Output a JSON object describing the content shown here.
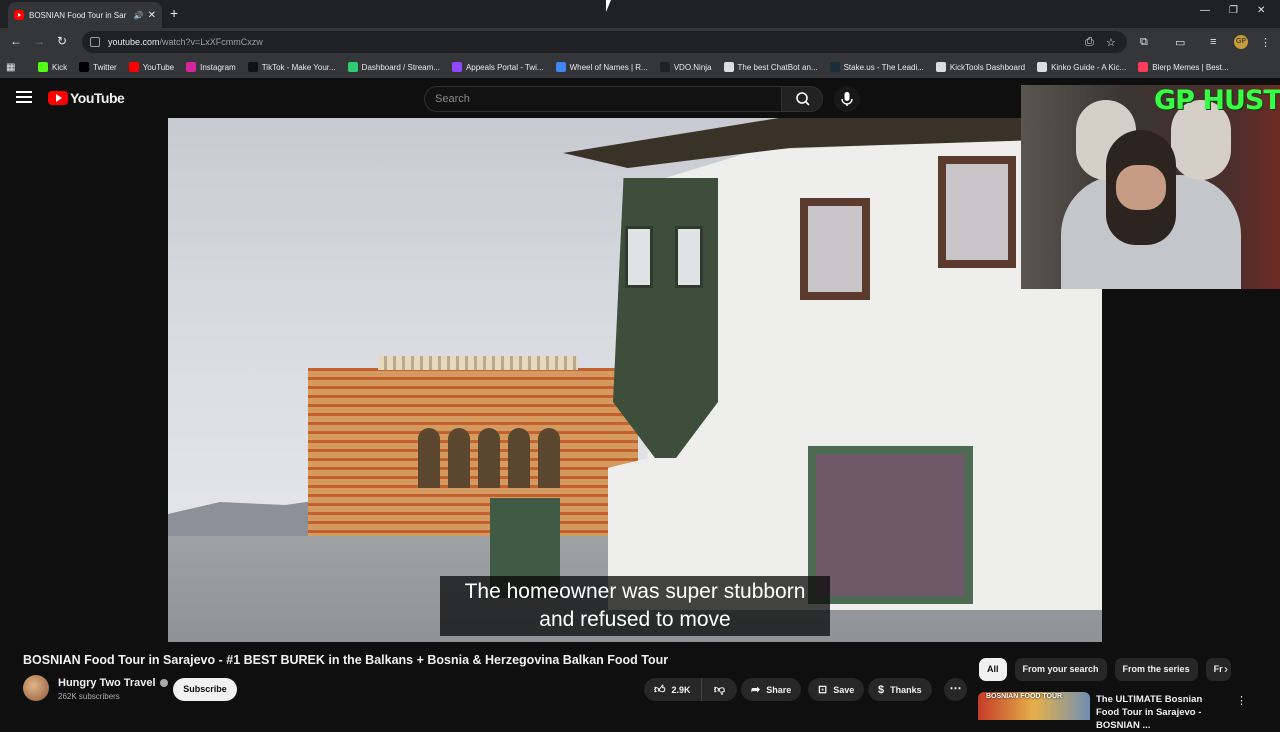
{
  "browser": {
    "tab_title": "BOSNIAN Food Tour in Sar",
    "url_host": "youtube.com",
    "url_path": "/watch?v=LxXFcmmCxzw",
    "profile_initial": "GP",
    "bookmarks": [
      {
        "label": "Kick",
        "color": "#53fc18"
      },
      {
        "label": "Twitter",
        "color": "#000000"
      },
      {
        "label": "YouTube",
        "color": "#ff0000"
      },
      {
        "label": "Instagram",
        "color": "#d6249f"
      },
      {
        "label": "TikTok - Make Your...",
        "color": "#111111"
      },
      {
        "label": "Dashboard / Stream...",
        "color": "#2ecc71"
      },
      {
        "label": "Appeals Portal - Twi...",
        "color": "#9146ff"
      },
      {
        "label": "Wheel of Names | R...",
        "color": "#4285f4"
      },
      {
        "label": "VDO.Ninja",
        "color": "#222222"
      },
      {
        "label": "The best ChatBot an...",
        "color": "#dddddd"
      },
      {
        "label": "Stake.us - The Leadi...",
        "color": "#1a2c38"
      },
      {
        "label": "KickTools Dashboard",
        "color": "#dddddd"
      },
      {
        "label": "Kinko Guide - A Kic...",
        "color": "#dddddd"
      },
      {
        "label": "Blerp Memes | Best...",
        "color": "#ff3b5c"
      }
    ]
  },
  "youtube": {
    "logo_text": "YouTube",
    "search_placeholder": "Search"
  },
  "video": {
    "subtitle_line1": "The homeowner was super stubborn",
    "subtitle_line2": "and refused to move",
    "title": "BOSNIAN Food Tour in Sarajevo - #1 BEST BUREK in the Balkans + Bosnia & Herzegovina Balkan Food Tour"
  },
  "overlay": {
    "brand_text": "GP HUSTLA"
  },
  "channel": {
    "name": "Hungry Two Travel",
    "subscribers": "262K subscribers",
    "subscribe_label": "Subscribe"
  },
  "actions": {
    "likes": "2.9K",
    "share": "Share",
    "save": "Save",
    "thanks": "Thanks"
  },
  "chips": [
    "All",
    "From your search",
    "From the series",
    "Fr"
  ],
  "recommendation": {
    "thumb_text": "BOSNIAN FOOD TOUR",
    "title": "The ULTIMATE Bosnian Food Tour in Sarajevo - BOSNIAN ..."
  }
}
